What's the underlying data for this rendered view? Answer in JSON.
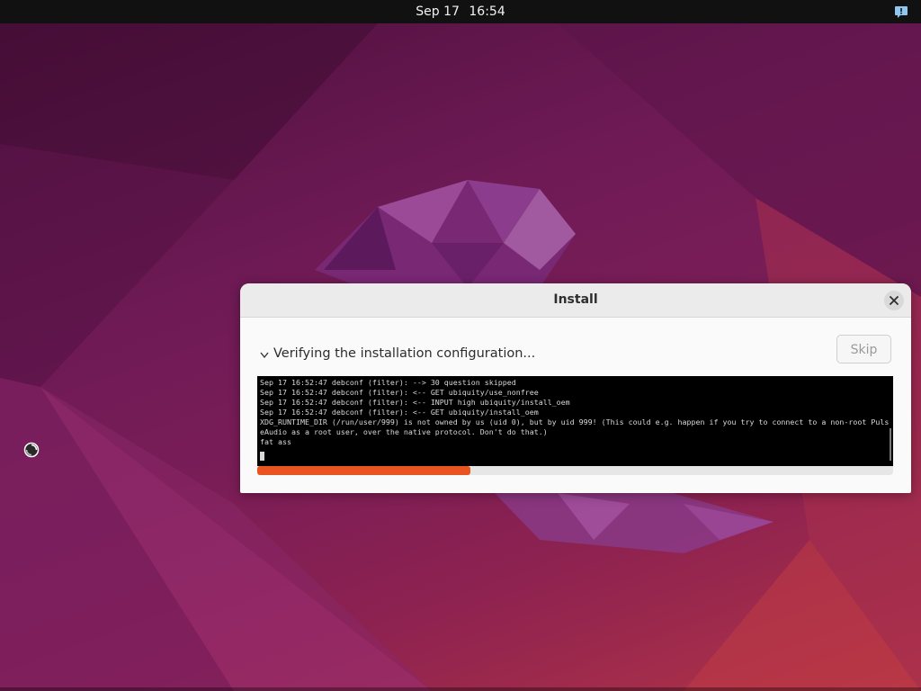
{
  "topbar": {
    "date": "Sep 17",
    "time": "16:54",
    "notification_icon": "notification-bubble-icon"
  },
  "colors": {
    "accent": "#e95420",
    "topbar_bg": "#111111",
    "terminal_bg": "#000000"
  },
  "window": {
    "title": "Install",
    "close_icon": "close-icon",
    "step_label": "Verifying the installation configuration...",
    "step_icon": "chevron-down-icon",
    "skip_label": "Skip",
    "log_lines": [
      "Sep 17 16:52:47 debconf (filter): --> 30 question skipped",
      "Sep 17 16:52:47 debconf (filter): <-- GET ubiquity/use_nonfree",
      "Sep 17 16:52:47 debconf (filter): <-- INPUT high ubiquity/install_oem",
      "Sep 17 16:52:47 debconf (filter): <-- GET ubiquity/install_oem",
      "XDG_RUNTIME_DIR (/run/user/999) is not owned by us (uid 0), but by uid 999! (This could e.g. happen if you try to connect to a non-root Puls",
      "eAudio as a root user, over the native protocol. Don't do that.)",
      "fat ass"
    ],
    "progress": 0.335
  }
}
